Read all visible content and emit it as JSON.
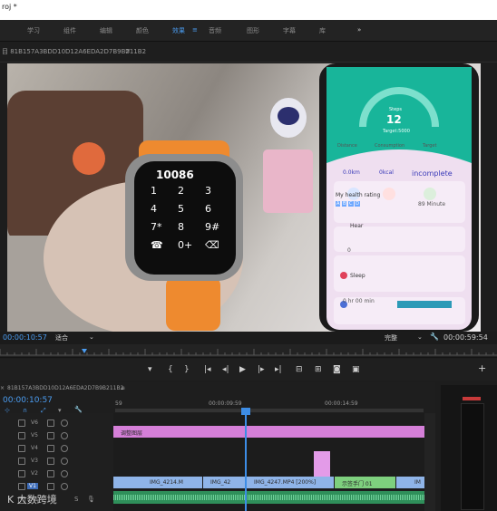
{
  "window": {
    "title": "roj *"
  },
  "workspaces": [
    {
      "label": "学习"
    },
    {
      "label": "组件"
    },
    {
      "label": "编辑"
    },
    {
      "label": "颜色"
    },
    {
      "label": "效果",
      "active": true
    },
    {
      "label": "音频"
    },
    {
      "label": "图形"
    },
    {
      "label": "字幕"
    },
    {
      "label": "库"
    },
    {
      "label": "»"
    }
  ],
  "monitor": {
    "clip_name": "目 81B157A3BDD10D12A6EDA2D7B9B211B2",
    "menu_icon": "≡",
    "timecode_current": "00:00:10:57",
    "fit_label": "适合",
    "quality_label": "完整",
    "timecode_duration": "00:00:59:54"
  },
  "watch": {
    "number": "10086",
    "keys": [
      "1",
      "2",
      "3",
      "4",
      "5",
      "6",
      "7*",
      "8",
      "9#",
      "☎",
      "0+",
      "⌫"
    ]
  },
  "phone": {
    "steps_label": "Steps",
    "steps_value": "12",
    "target_label": "Target:5000",
    "stats": [
      {
        "label": "Distance",
        "value": "0.0km"
      },
      {
        "label": "Consumption",
        "value": "0kcal"
      },
      {
        "label": "Target",
        "value": "incomplete"
      }
    ],
    "health_label": "My health rating",
    "health_value": "89 Minute",
    "health_letters": [
      "A",
      "B",
      "C",
      "D"
    ],
    "heart_label": "Hear",
    "heart_value": "0",
    "sleep_label": "Sleep",
    "sleep_value": "0 hr 00 min"
  },
  "sequence": {
    "name": "81B157A3BDD10D12A6EDA2D7B9B211B2",
    "timecode": "00:00:10:57",
    "ruler_labels": [
      "59",
      "00:00:09:59",
      "00:00:14:59"
    ],
    "tracks": [
      {
        "label": "V6"
      },
      {
        "label": "V5"
      },
      {
        "label": "V4"
      },
      {
        "label": "V3"
      },
      {
        "label": "V2"
      },
      {
        "label": "V1"
      },
      {
        "label": "A1"
      }
    ],
    "clips": [
      {
        "label": "调整图层",
        "color": "#d57fd8"
      },
      {
        "label": "",
        "color": "#e39be8"
      },
      {
        "label": "IMG_4214.M",
        "color": "#8fb4e8"
      },
      {
        "label": "IMG_42",
        "color": "#8fb4e8"
      },
      {
        "label": "IMG_4247.MP4 [200%]",
        "color": "#8fb4e8"
      },
      {
        "label": "示签手门 01",
        "color": "#7ed07e"
      },
      {
        "label": "IM",
        "color": "#8fb4e8"
      }
    ]
  },
  "watermark": {
    "text": "大数跨境"
  },
  "colors": {
    "accent": "#4b9cf0",
    "playhead": "#3d8de6",
    "adjustment": "#d57fd8",
    "video_clip": "#8fb4e8",
    "title_clip": "#7ed07e",
    "audio": "#2f8f5a"
  }
}
